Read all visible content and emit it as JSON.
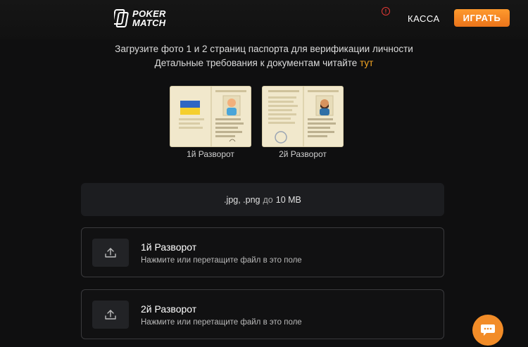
{
  "header": {
    "logo_line1": "POKER",
    "logo_line2": "MATCH",
    "alert": "!",
    "cashier_label": "КАССА",
    "play_label": "ИГРАТЬ"
  },
  "intro": {
    "line1": "Загрузите фото 1 и 2 страниц паспорта для верификации личности",
    "line2_text": "Детальные требования к документам читайте",
    "line2_link": "тут"
  },
  "examples": [
    {
      "label": "1й Разворот"
    },
    {
      "label": "2й Разворот"
    }
  ],
  "formats": {
    "types": ".jpg, .png",
    "connector": "до",
    "size": "10 MB"
  },
  "uploads": [
    {
      "title": "1й Разворот",
      "hint": "Нажмите или перетащите файл в это поле"
    },
    {
      "title": "2й Разворот",
      "hint": "Нажмите или перетащите файл в это поле"
    }
  ],
  "colors": {
    "accent": "#f28c28",
    "link": "#f5a623",
    "background": "#0f0f10",
    "alert": "#e53935"
  },
  "icons": [
    "logo-icon",
    "alert-icon",
    "upload-icon",
    "chat-icon"
  ]
}
